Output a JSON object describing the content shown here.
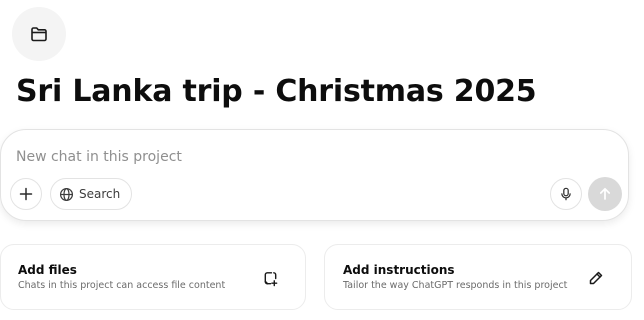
{
  "project": {
    "icon": "folder-icon",
    "title": "Sri Lanka trip - Christmas 2025"
  },
  "composer": {
    "placeholder": "New chat in this project",
    "value": "",
    "plus_icon": "plus-icon",
    "search_icon": "globe-icon",
    "search_label": "Search",
    "mic_icon": "microphone-icon",
    "send_icon": "arrow-up-icon"
  },
  "cards": {
    "files": {
      "title": "Add files",
      "description": "Chats in this project can access file content",
      "icon": "add-file-icon"
    },
    "instructions": {
      "title": "Add instructions",
      "description": "Tailor the way ChatGPT responds in this project",
      "icon": "pencil-icon"
    }
  },
  "colors": {
    "text": "#0d0d0d",
    "muted": "#6b6b6b",
    "placeholder": "#8f8f8f",
    "border": "#e3e3e3",
    "icon_bg": "#f4f4f4",
    "send_disabled": "#d9d9d9"
  }
}
